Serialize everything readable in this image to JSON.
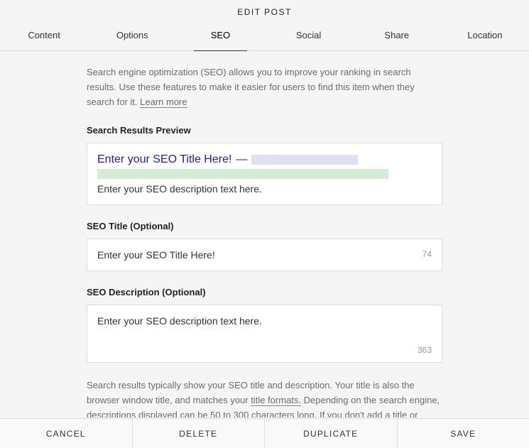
{
  "header": {
    "title": "EDIT POST"
  },
  "tabs": [
    {
      "label": "Content",
      "active": false
    },
    {
      "label": "Options",
      "active": false
    },
    {
      "label": "SEO",
      "active": true
    },
    {
      "label": "Social",
      "active": false
    },
    {
      "label": "Share",
      "active": false
    },
    {
      "label": "Location",
      "active": false
    }
  ],
  "intro": {
    "text": "Search engine optimization (SEO) allows you to improve your ranking in search results. Use these features to make it easier for users to find this item when they search for it. ",
    "learn_more": "Learn more"
  },
  "preview": {
    "label": "Search Results Preview",
    "title": "Enter your SEO Title Here!",
    "dash": "—",
    "description": "Enter your SEO description text here."
  },
  "seo_title": {
    "label": "SEO Title (Optional)",
    "value": "Enter your SEO Title Here!",
    "count": "74"
  },
  "seo_description": {
    "label": "SEO Description (Optional)",
    "value": "Enter your SEO description text here.",
    "count": "363"
  },
  "footer": {
    "text1": "Search results typically show your SEO title and description. Your title is also the browser window title, and matches your ",
    "link": "title formats.",
    "text2": " Depending on the search engine, descriptions displayed can be 50 to 300 characters long. If you don't add a title or description, search engines will use this item's title and content."
  },
  "actions": {
    "cancel": "CANCEL",
    "delete": "DELETE",
    "duplicate": "DUPLICATE",
    "save": "SAVE"
  }
}
